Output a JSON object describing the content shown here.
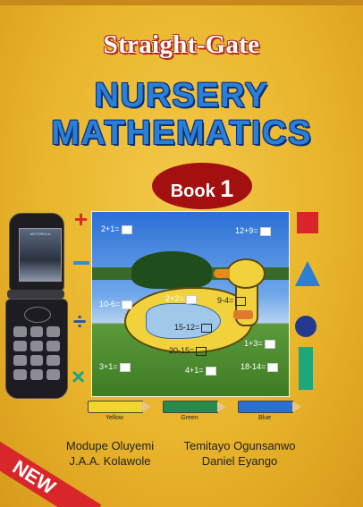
{
  "cover": {
    "series": "Straight-Gate",
    "title_line1": "NURSERY",
    "title_line2": "MATHEMATICS",
    "book_word": "Book",
    "book_number": "1",
    "phone_brand": "MOTOROLA",
    "equations": [
      {
        "text": "2+1="
      },
      {
        "text": "12+9="
      },
      {
        "text": "10-6="
      },
      {
        "text": "2+2="
      },
      {
        "text": "9-4="
      },
      {
        "text": "15-12="
      },
      {
        "text": "1+3="
      },
      {
        "text": "20-15="
      },
      {
        "text": "3+1="
      },
      {
        "text": "4+1="
      },
      {
        "text": "18-14="
      }
    ],
    "pencils": [
      {
        "label": "Yellow",
        "color": "#f4d62a"
      },
      {
        "label": "Green",
        "color": "#2a8a4a"
      },
      {
        "label": "Blue",
        "color": "#2a6fd6"
      }
    ],
    "authors_left": [
      "Modupe Oluyemi",
      "J.A.A. Kolawole"
    ],
    "authors_right": [
      "Temitayo Ogunsanwo",
      "Daniel Eyango"
    ],
    "banner": "NEW",
    "colors": {
      "background": "#e9b52c",
      "title_blue": "#2a7fd6",
      "series_red": "#b22a1e",
      "book_red": "#a41010"
    }
  }
}
